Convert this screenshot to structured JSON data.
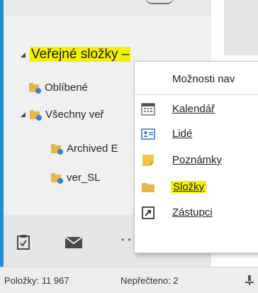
{
  "folder_tree": {
    "root": {
      "label": "Veřejné složky –"
    },
    "items": [
      {
        "label": "Oblíbené"
      },
      {
        "label": "Všechny veř"
      },
      {
        "label": "Archived E"
      },
      {
        "label": "ver_SL"
      }
    ]
  },
  "nav_bar": {
    "icons": [
      "tasks-icon",
      "mail-icon"
    ],
    "more": "• • •"
  },
  "context_menu": {
    "header": "Možnosti nav",
    "items": [
      {
        "label": "Kalendář",
        "icon": "calendar-icon"
      },
      {
        "label": "Lidé",
        "icon": "contacts-icon"
      },
      {
        "label": "Poznámky",
        "icon": "notes-icon"
      },
      {
        "label": "Složky",
        "icon": "folder-icon",
        "highlighted": true
      },
      {
        "label": "Zástupci",
        "icon": "shortcut-icon"
      }
    ]
  },
  "status_bar": {
    "items_label": "Položky: 11 967",
    "unread_label": "Nepřečteno: 2"
  },
  "colors": {
    "highlight": "#f5ef00",
    "window_border": "#1e8fd6",
    "folder": "#e7b64a"
  }
}
